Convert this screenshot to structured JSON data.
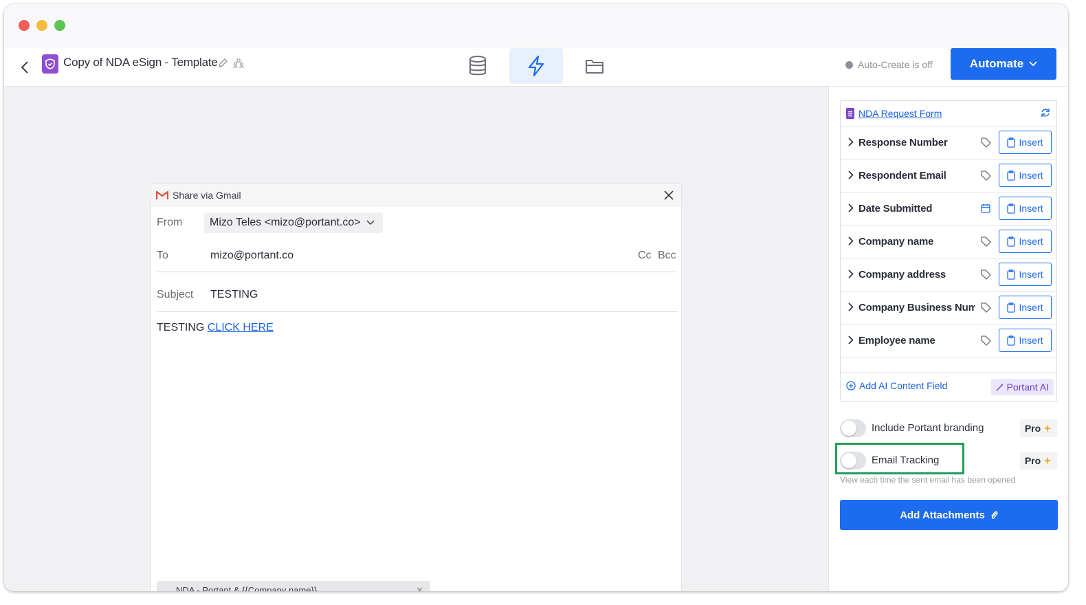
{
  "app": {
    "doc_title": "Copy of NDA eSign - Template",
    "auto_create": "Auto-Create is off",
    "automate_label": "Automate",
    "nav_tabs": [
      "database-icon",
      "lightning-icon",
      "folder-icon"
    ],
    "accent_color": "#1d6cf0"
  },
  "gmail": {
    "header_title": "Share via Gmail",
    "from_label": "From",
    "from_value": "Mizo Teles <mizo@portant.co>",
    "to_label": "To",
    "to_value": "mizo@portant.co",
    "cc_label": "Cc",
    "bcc_label": "Bcc",
    "subject_label": "Subject",
    "subject_value": "TESTING",
    "body_text": "TESTING ",
    "body_link": "CLICK HERE ",
    "attachment": "NDA - Portant & {{Company name}}"
  },
  "panel": {
    "form_name": "NDA Request Form",
    "fields": [
      {
        "name": "Response Number",
        "type_icon": "tag-icon"
      },
      {
        "name": "Respondent Email",
        "type_icon": "tag-icon"
      },
      {
        "name": "Date Submitted",
        "type_icon": "calendar-icon"
      },
      {
        "name": "Company name",
        "type_icon": "tag-icon"
      },
      {
        "name": "Company address",
        "type_icon": "tag-icon"
      },
      {
        "name": "Company Business Num...",
        "type_icon": "tag-icon"
      },
      {
        "name": "Employee name",
        "type_icon": "tag-icon"
      }
    ],
    "insert_label": "Insert",
    "add_ai_label": "Add AI Content Field",
    "portant_ai_label": "Portant AI",
    "branding_label": "Include Portant branding",
    "tracking_label": "Email Tracking",
    "pro_label": "Pro",
    "tracking_hint": "View each time the sent email has been opened",
    "attach_label": "Add Attachments",
    "highlight_color": "#1e9e5b"
  }
}
